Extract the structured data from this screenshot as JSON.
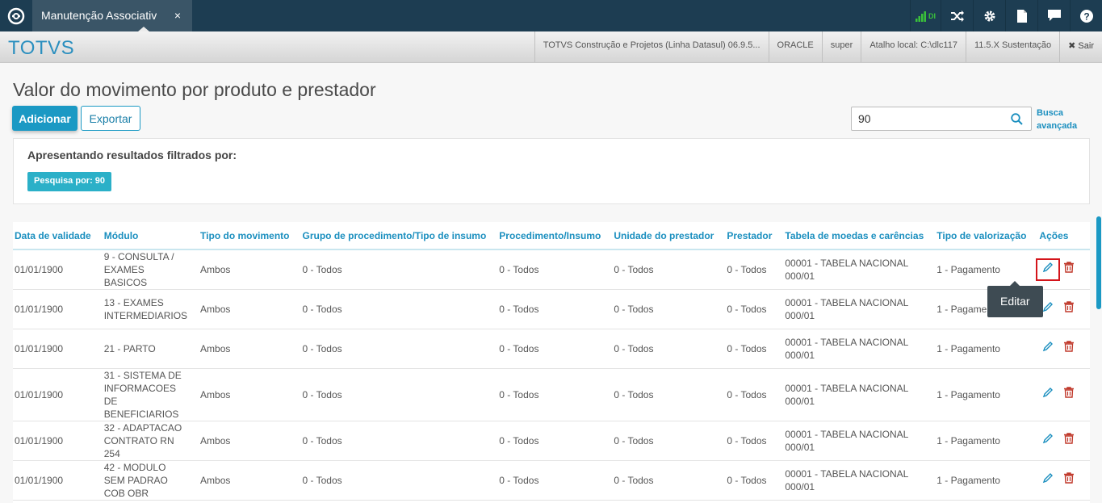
{
  "tab": {
    "title": "Manutenção Associativa",
    "close": "×"
  },
  "toolbar": {
    "signal_text": "DI",
    "icons": [
      "shuffle-icon",
      "gear-icon",
      "document-icon",
      "chat-icon",
      "help-icon"
    ]
  },
  "header": {
    "brand": "TOTVS",
    "info": [
      "TOTVS Construção e Projetos (Linha Datasul) 06.9.5...",
      "ORACLE",
      "super",
      "Atalho local: C:\\dlc117",
      "11.5.X Sustentação"
    ],
    "exit_label": "✖ Sair"
  },
  "page": {
    "title": "Valor do movimento por produto e prestador",
    "add_label": "Adicionar",
    "export_label": "Exportar",
    "search_value": "90",
    "advanced_search": "Busca avançada"
  },
  "filter": {
    "title": "Apresentando resultados filtrados por:",
    "tag": "Pesquisa por: 90"
  },
  "table": {
    "columns": [
      "Data de validade",
      "Módulo",
      "Tipo do movimento",
      "Grupo de procedimento/Tipo de insumo",
      "Procedimento/Insumo",
      "Unidade do prestador",
      "Prestador",
      "Tabela de moedas e carências",
      "Tipo de valorização",
      "Ações"
    ],
    "rows": [
      {
        "data": "01/01/1900",
        "modulo": "9 - CONSULTA / EXAMES BASICOS",
        "tipo": "Ambos",
        "grupo": "0 - Todos",
        "proc": "0 - Todos",
        "unidade": "0 - Todos",
        "prestador": "0 - Todos",
        "tabela": "00001 - TABELA NACIONAL 000/01",
        "valorizacao": "1 - Pagamento"
      },
      {
        "data": "01/01/1900",
        "modulo": "13 - EXAMES INTERMEDIARIOS",
        "tipo": "Ambos",
        "grupo": "0 - Todos",
        "proc": "0 - Todos",
        "unidade": "0 - Todos",
        "prestador": "0 - Todos",
        "tabela": "00001 - TABELA NACIONAL 000/01",
        "valorizacao": "1 - Pagamento"
      },
      {
        "data": "01/01/1900",
        "modulo": "21 - PARTO",
        "tipo": "Ambos",
        "grupo": "0 - Todos",
        "proc": "0 - Todos",
        "unidade": "0 - Todos",
        "prestador": "0 - Todos",
        "tabela": "00001 - TABELA NACIONAL 000/01",
        "valorizacao": "1 - Pagamento"
      },
      {
        "data": "01/01/1900",
        "modulo": "31 - SISTEMA DE INFORMACOES DE BENEFICIARIOS",
        "tipo": "Ambos",
        "grupo": "0 - Todos",
        "proc": "0 - Todos",
        "unidade": "0 - Todos",
        "prestador": "0 - Todos",
        "tabela": "00001 - TABELA NACIONAL 000/01",
        "valorizacao": "1 - Pagamento"
      },
      {
        "data": "01/01/1900",
        "modulo": "32 - ADAPTACAO CONTRATO RN 254",
        "tipo": "Ambos",
        "grupo": "0 - Todos",
        "proc": "0 - Todos",
        "unidade": "0 - Todos",
        "prestador": "0 - Todos",
        "tabela": "00001 - TABELA NACIONAL 000/01",
        "valorizacao": "1 - Pagamento"
      },
      {
        "data": "01/01/1900",
        "modulo": "42 - MODULO SEM PADRAO COB OBR",
        "tipo": "Ambos",
        "grupo": "0 - Todos",
        "proc": "0 - Todos",
        "unidade": "0 - Todos",
        "prestador": "0 - Todos",
        "tabela": "00001 - TABELA NACIONAL 000/01",
        "valorizacao": "1 - Pagamento"
      }
    ]
  },
  "tooltip": {
    "text": "Editar"
  },
  "colors": {
    "accent": "#1b99c4",
    "topbar": "#1d3d52",
    "delete": "#c0392b",
    "highlight": "#d4151b"
  }
}
